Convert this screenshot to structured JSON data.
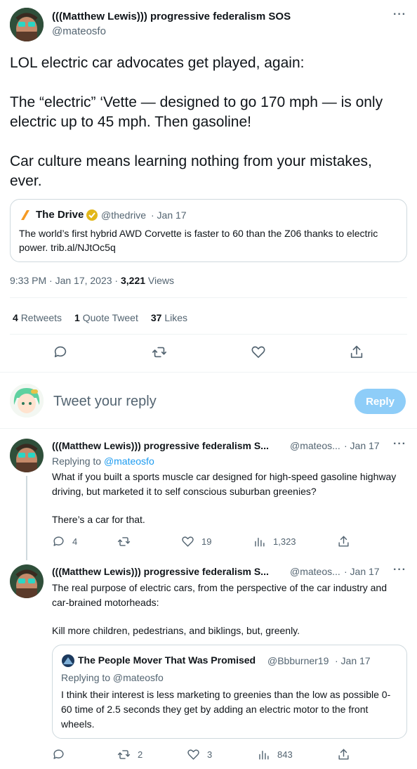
{
  "main_tweet": {
    "author_name": "(((Matthew Lewis))) progressive federalism SOS",
    "author_handle": "@mateosfo",
    "text_line1": "LOL electric car advocates get played, again:",
    "text_line2": "The “electric” ‘Vette — designed to go 170 mph — is only electric up to 45 mph. Then gasoline!",
    "text_line3": "Car culture means learning nothing from your mistakes, ever.",
    "quote": {
      "name": "The Drive",
      "handle": "@thedrive",
      "date": "· Jan 17",
      "text": "The world’s first hybrid AWD Corvette is faster to 60 than the Z06 thanks to electric power. trib.al/NJtOc5q"
    },
    "time": "9:33 PM · Jan 17, 2023 ·",
    "views_count": "3,221",
    "views_label": "Views",
    "stats": {
      "retweets_count": "4",
      "retweets_label": "Retweets",
      "quotes_count": "1",
      "quotes_label": "Quote Tweet",
      "likes_count": "37",
      "likes_label": "Likes"
    }
  },
  "reply_box": {
    "placeholder": "Tweet your reply",
    "button_label": "Reply",
    "button_color": "#8ecdf8"
  },
  "reply1": {
    "author_name": "(((Matthew Lewis))) progressive federalism S...",
    "author_handle": "@mateos...",
    "date": "· Jan 17",
    "replying_prefix": "Replying to",
    "replying_handle": "@mateosfo",
    "text1": "What if you built a sports muscle car designed for high-speed gasoline highway driving, but marketed it to self conscious suburban greenies?",
    "text2": "There’s a car for that.",
    "replies": "4",
    "retweets": "",
    "likes": "19",
    "views": "1,323"
  },
  "reply2": {
    "author_name": "(((Matthew Lewis))) progressive federalism S...",
    "author_handle": "@mateos...",
    "date": "· Jan 17",
    "text1": "The real purpose of electric cars, from the perspective of the car industry and car-brained motorheads:",
    "text2": "Kill more children, pedestrians, and biklings, but, greenly.",
    "quote": {
      "name": "The People Mover That Was Promised",
      "handle": "@Bbburner19",
      "date": "· Jan 17",
      "replying": "Replying to @mateosfo",
      "text": "I think their interest is less marketing to greenies than the low as possible 0-60 time of 2.5 seconds they get by adding an electric motor to the front wheels."
    },
    "replies": "",
    "retweets": "2",
    "likes": "3",
    "views": "843"
  },
  "more_label": "···",
  "colors": {
    "accent": "#1d9bf0",
    "muted": "#536471",
    "verified_gold": "#e2b719",
    "thedrive_orange": "#f59a23"
  }
}
